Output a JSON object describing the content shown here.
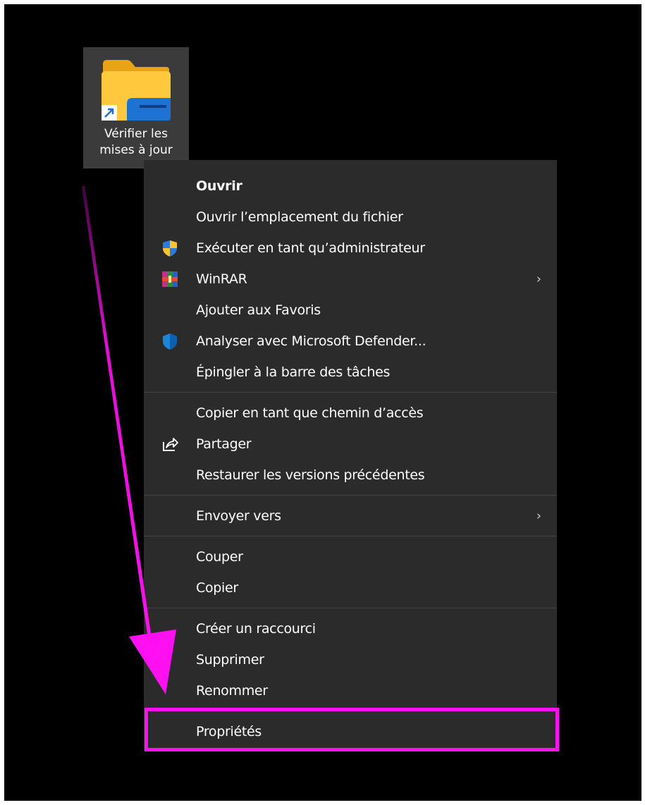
{
  "desktop": {
    "shortcut": {
      "label_line1": "Vérifier les",
      "label_line2": "mises à jour",
      "icon": "folder-shortcut-icon"
    }
  },
  "context_menu": {
    "items": [
      {
        "label": "Ouvrir",
        "bold": true
      },
      {
        "label": "Ouvrir l’emplacement du fichier"
      },
      {
        "label": "Exécuter en tant qu’administrateur",
        "icon": "uac-shield-icon"
      },
      {
        "label": "WinRAR",
        "icon": "winrar-icon",
        "submenu": true
      },
      {
        "label": "Ajouter aux Favoris"
      },
      {
        "label": "Analyser avec Microsoft Defender...",
        "icon": "defender-icon"
      },
      {
        "label": "Épingler à la barre des tâches"
      },
      {
        "label": "Copier en tant que chemin d’accès"
      },
      {
        "label": "Partager",
        "icon": "share-icon"
      },
      {
        "label": "Restaurer les versions précédentes"
      },
      {
        "label": "Envoyer vers",
        "submenu": true
      },
      {
        "label": "Couper"
      },
      {
        "label": "Copier"
      },
      {
        "label": "Créer un raccourci"
      },
      {
        "label": "Supprimer"
      },
      {
        "label": "Renommer"
      },
      {
        "label": "Propriétés",
        "highlighted": true
      }
    ],
    "chevron": "›"
  },
  "annotation": {
    "color": "#ff10f0"
  }
}
